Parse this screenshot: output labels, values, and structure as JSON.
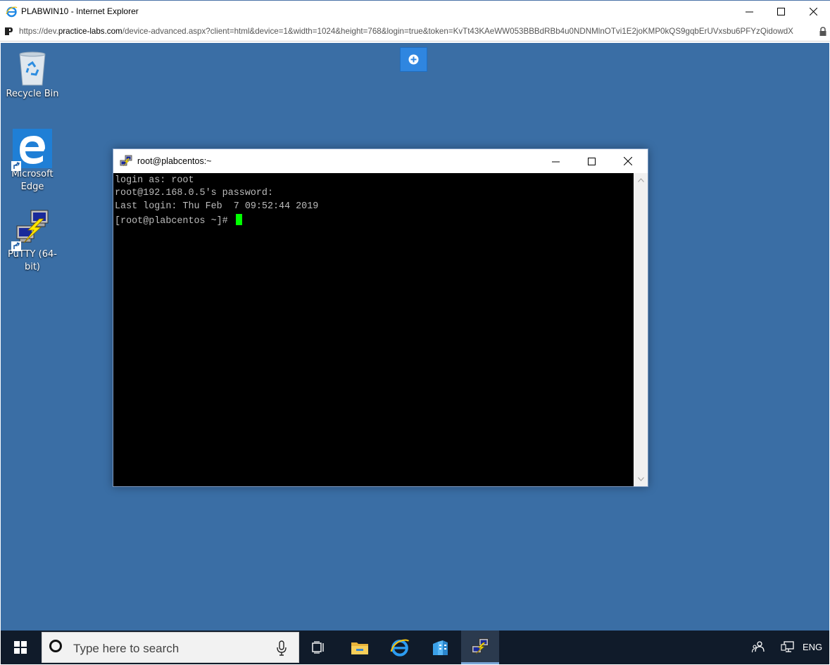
{
  "ie": {
    "title": "PLABWIN10 - Internet Explorer",
    "url_prefix": "https://dev.",
    "url_host": "practice-labs.com",
    "url_rest": "/device-advanced.aspx?client=html&device=1&width=1024&height=768&login=true&token=KvTt43KAeWW053BBBdRBb4u0NDNMlnOTvi1E2joKMP0kQS9gqbErUVxsbu6PFYzQidowdX"
  },
  "desktop": {
    "icons": [
      {
        "name": "Recycle Bin",
        "icon": "recycle-bin-icon"
      },
      {
        "name": "Microsoft Edge",
        "icon": "edge-icon"
      },
      {
        "name": "PuTTY (64-bit)",
        "icon": "putty-icon"
      }
    ]
  },
  "putty": {
    "title": "root@plabcentos:~",
    "lines": [
      "login as: root",
      "root@192.168.0.5's password:",
      "Last login: Thu Feb  7 09:52:44 2019",
      "[root@plabcentos ~]# "
    ],
    "cursor_color": "#00ff00"
  },
  "taskbar": {
    "search_placeholder": "Type here to search",
    "apps": [
      "task-view",
      "file-explorer",
      "internet-explorer",
      "server-manager",
      "putty"
    ],
    "active_app": "putty",
    "language": "ENG"
  },
  "colors": {
    "desktop": "#3a6ea5",
    "taskbar": "#101b2a",
    "terminal_bg": "#000000",
    "terminal_fg": "#bbbbbb"
  }
}
